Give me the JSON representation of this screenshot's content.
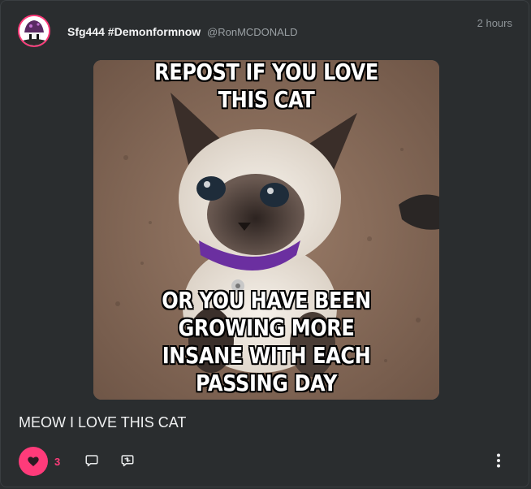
{
  "post": {
    "author_name": "Sfg444 #Demonformnow",
    "author_handle": "@RonMCDONALD",
    "time": "2 hours",
    "meme_top_line1": "REPOST IF YOU LOVE",
    "meme_top_line2": "THIS CAT",
    "meme_bottom_line1": "OR YOU HAVE BEEN GROWING MORE",
    "meme_bottom_line2": "INSANE WITH EACH PASSING DAY",
    "caption": "MEOW I LOVE THIS CAT",
    "likes": "3"
  },
  "colors": {
    "accent": "#ff3b7a",
    "background": "#2a2d2f",
    "text_muted": "#9aa0a4"
  },
  "icons": {
    "like": "heart-icon",
    "comment": "comment-icon",
    "share": "repost-icon",
    "more": "more-vertical-icon"
  }
}
